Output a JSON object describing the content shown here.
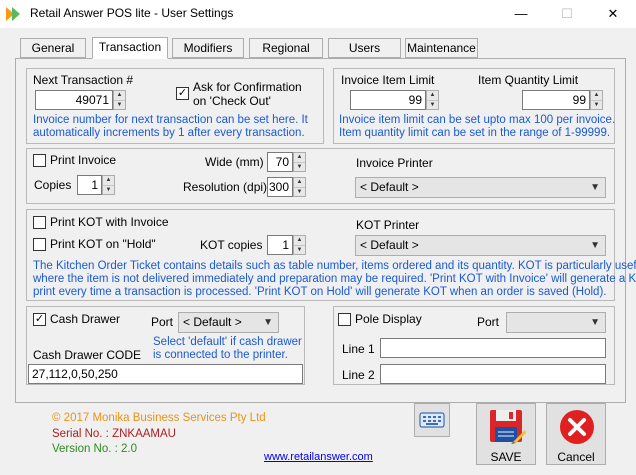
{
  "window": {
    "title": "Retail Answer POS lite - User Settings",
    "min": "—",
    "max": "☐",
    "close": "✕"
  },
  "tabs": [
    {
      "label": "General"
    },
    {
      "label": "Transaction"
    },
    {
      "label": "Modifiers"
    },
    {
      "label": "Regional"
    },
    {
      "label": "Users"
    },
    {
      "label": "Maintenance"
    }
  ],
  "transaction": {
    "next_label": "Next Transaction #",
    "next_value": "49071",
    "confirm_label_1": "Ask for Confirmation",
    "confirm_label_2": "on 'Check Out'",
    "confirm_checked": "✓",
    "note_1": "Invoice number for next transaction can be set here. It",
    "note_2": "automatically increments by 1 after every transaction."
  },
  "limits": {
    "item_label": "Invoice Item Limit",
    "qty_label": "Item Quantity Limit",
    "item_value": "99",
    "qty_value": "99",
    "note_1": "Invoice item limit can be set upto max 100 per invoice.",
    "note_2": "Item quantity limit can be set in the range of 1-99999."
  },
  "invoice": {
    "print_label": "Print Invoice",
    "copies_label": "Copies",
    "copies_value": "1",
    "wide_label": "Wide (mm)",
    "wide_value": "70",
    "res_label": "Resolution (dpi)",
    "res_value": "300",
    "printer_label": "Invoice Printer",
    "printer_value": "< Default >"
  },
  "kot": {
    "with_invoice_label": "Print KOT with Invoice",
    "on_hold_label": "Print KOT on \"Hold\"",
    "copies_label": "KOT copies",
    "copies_value": "1",
    "printer_label": "KOT Printer",
    "printer_value": "< Default >",
    "note_1": "The Kitchen Order Ticket contains details such as table number, items ordered and its quantity. KOT is particularly useful",
    "note_2": "where the item is not delivered immediately and preparation may be required. 'Print KOT with Invoice' will generate a KOT",
    "note_3": "print every time a transaction is processed. 'Print KOT on Hold' will generate KOT when an order is saved (Hold)."
  },
  "cash": {
    "label": "Cash Drawer",
    "checked": "✓",
    "port_label": "Port",
    "port_value": "< Default >",
    "note_1": "Select 'default' if cash drawer",
    "note_2": "is connected to the printer.",
    "code_label": "Cash Drawer CODE",
    "code_value": "27,112,0,50,250"
  },
  "pole": {
    "label": "Pole Display",
    "port_label": "Port",
    "port_value": "",
    "line1_label": "Line 1",
    "line2_label": "Line 2",
    "line1_value": "",
    "line2_value": ""
  },
  "footer": {
    "copyright": "© 2017 Monika Business Services Pty Ltd",
    "serial": "Serial No. : ZNKAAMAU",
    "version": "Version No. : 2.0",
    "website": "www.retailanswer.com",
    "save_label": "SAVE",
    "cancel_label": "Cancel"
  },
  "colors": {
    "note_blue": "#1a5ad4",
    "copyright_orange": "#e8931c",
    "serial_red": "#b02020",
    "version_green": "#2f8a1f",
    "link_blue": "#0000ee",
    "cancel_red": "#e02020"
  },
  "icons": [
    "app-icon",
    "keyboard-icon",
    "save-disk-icon",
    "cancel-x-icon",
    "spin-up-icon",
    "spin-down-icon",
    "chevron-down-icon"
  ]
}
